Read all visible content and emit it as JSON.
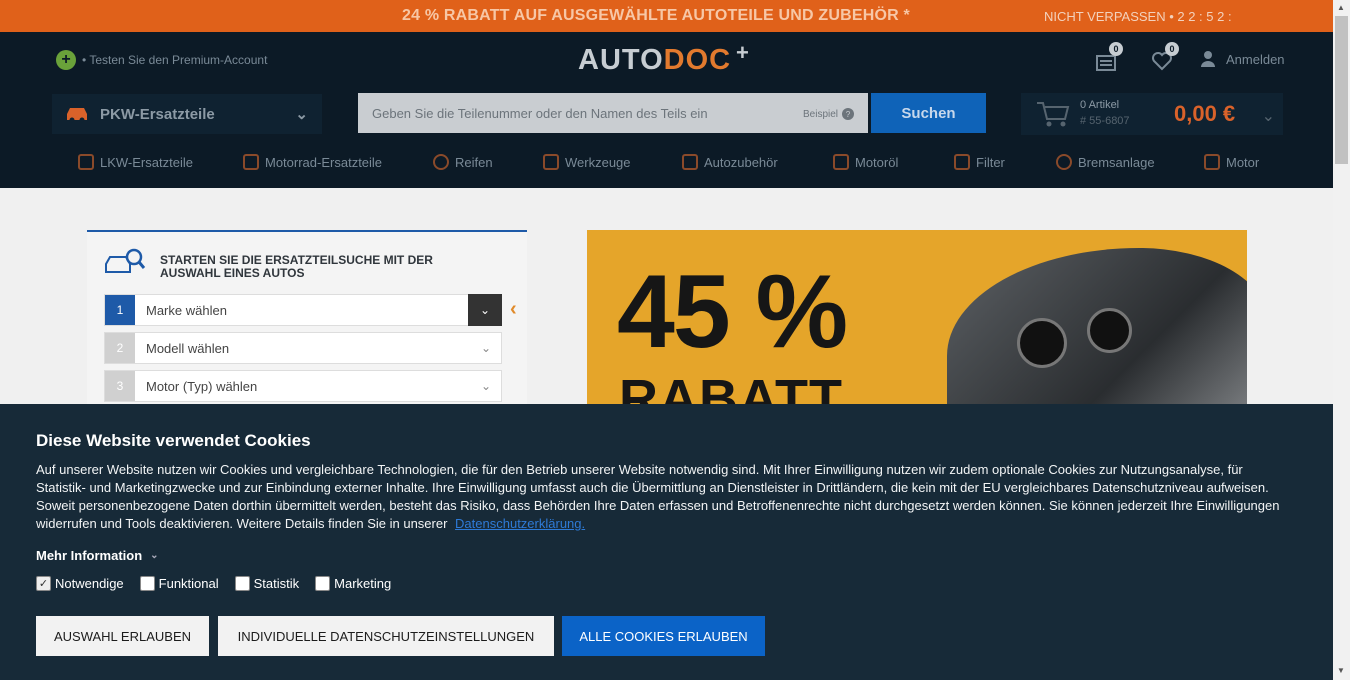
{
  "promo": {
    "text": "24 % RABATT AUF AUSGEWÄHLTE AUTOTEILE UND ZUBEHÖR *",
    "timer": "NICHT VERPASSEN • 2 2 : 5 2 :"
  },
  "header": {
    "premium": "• Testen Sie den Premium-Account",
    "logo_a": "AUTO",
    "logo_b": "DOC",
    "logo_plus": "+",
    "garage_badge": "0",
    "wishlist_badge": "0",
    "login": "Anmelden",
    "category": "PKW-Ersatzteile",
    "search_placeholder": "Geben Sie die Teilenummer oder den Namen des Teils ein",
    "beispiel": "Beispiel",
    "search_button": "Suchen",
    "cart_count": "0 Artikel",
    "cart_number": "# 55-6807",
    "cart_total": "0,00 €"
  },
  "nav": [
    {
      "label": "LKW-Ersatzteile",
      "icon": "truck-icon"
    },
    {
      "label": "Motorrad-Ersatzteile",
      "icon": "motorbike-icon"
    },
    {
      "label": "Reifen",
      "icon": "tire-icon"
    },
    {
      "label": "Werkzeuge",
      "icon": "tools-icon"
    },
    {
      "label": "Autozubehör",
      "icon": "accessory-icon"
    },
    {
      "label": "Motoröl",
      "icon": "oil-icon"
    },
    {
      "label": "Filter",
      "icon": "filter-icon"
    },
    {
      "label": "Bremsanlage",
      "icon": "brake-icon"
    },
    {
      "label": "Motor",
      "icon": "engine-icon"
    }
  ],
  "finder": {
    "title": "STARTEN SIE DIE ERSATZTEILSUCHE MIT DER AUSWAHL EINES AUTOS",
    "steps": [
      {
        "num": "1",
        "label": "Marke wählen"
      },
      {
        "num": "2",
        "label": "Modell wählen"
      },
      {
        "num": "3",
        "label": "Motor (Typ) wählen"
      }
    ]
  },
  "banner": {
    "percent": "45 %",
    "rabatt": "RABATT"
  },
  "cookie": {
    "title": "Diese Website verwendet Cookies",
    "text": "Auf unserer Website nutzen wir Cookies und vergleichbare Technologien, die für den Betrieb unserer Website notwendig sind. Mit Ihrer Einwilligung nutzen wir zudem optionale Cookies zur Nutzungsanalyse, für Statistik- und Marketingzwecke und zur Einbindung externer Inhalte. Ihre Einwilligung umfasst auch die Übermittlung an Dienstleister in Drittländern, die kein mit der EU vergleichbares Datenschutzniveau aufweisen. Soweit personenbezogene Daten dorthin übermittelt werden, besteht das Risiko, dass Behörden Ihre Daten erfassen und Betroffenenrechte nicht durchgesetzt werden können. Sie können jederzeit Ihre Einwilligungen widerrufen und Tools deaktivieren. Weitere Details finden Sie in unserer",
    "link": "Datenschutzerklärung.",
    "more": "Mehr Information",
    "checks": [
      {
        "label": "Notwendige",
        "checked": true
      },
      {
        "label": "Funktional",
        "checked": false
      },
      {
        "label": "Statistik",
        "checked": false
      },
      {
        "label": "Marketing",
        "checked": false
      }
    ],
    "btn_select": "AUSWAHL ERLAUBEN",
    "btn_individual": "INDIVIDUELLE DATENSCHUTZEINSTELLUNGEN",
    "btn_all": "ALLE COOKIES ERLAUBEN"
  }
}
